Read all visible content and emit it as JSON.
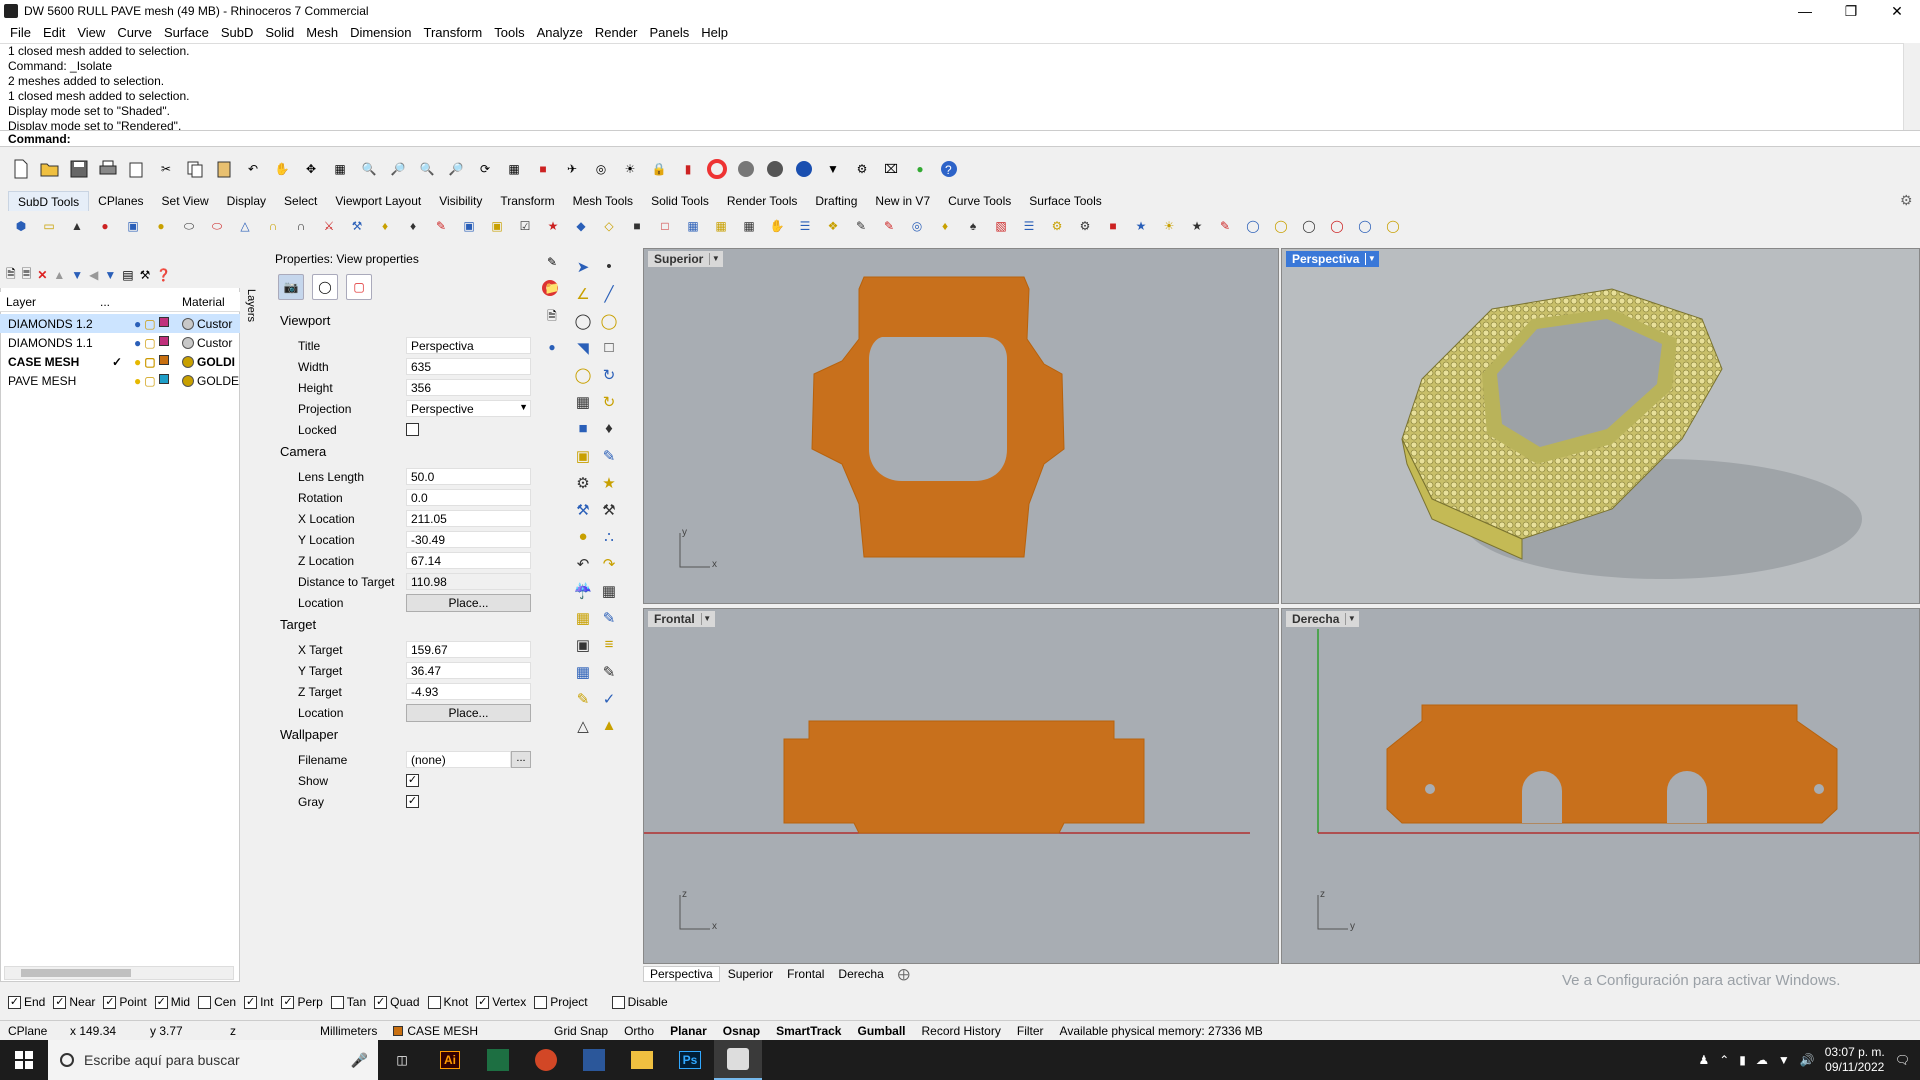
{
  "window": {
    "title": "DW 5600 RULL PAVE mesh (49 MB) - Rhinoceros 7 Commercial"
  },
  "menu": [
    "File",
    "Edit",
    "View",
    "Curve",
    "Surface",
    "SubD",
    "Solid",
    "Mesh",
    "Dimension",
    "Transform",
    "Tools",
    "Analyze",
    "Render",
    "Panels",
    "Help"
  ],
  "command_history": [
    "1 closed mesh added to selection.",
    "Command: _Isolate",
    "2 meshes added to selection.",
    "1 closed mesh added to selection.",
    "Display mode set to \"Shaded\".",
    "Display mode set to \"Rendered\"."
  ],
  "command_prompt": "Command:",
  "toolbar_tabs": [
    "SubD Tools",
    "CPlanes",
    "Set View",
    "Display",
    "Select",
    "Viewport Layout",
    "Visibility",
    "Transform",
    "Mesh Tools",
    "Solid Tools",
    "Render Tools",
    "Drafting",
    "New in V7",
    "Curve Tools",
    "Surface Tools"
  ],
  "layers": {
    "headers": {
      "layer": "Layer",
      "current": "...",
      "material": "Material"
    },
    "rows": [
      {
        "name": "DIAMONDS 1.2",
        "current": "",
        "material": "Custor",
        "color": "#c0307c",
        "selected": true,
        "bold": false
      },
      {
        "name": "DIAMONDS 1.1",
        "current": "",
        "material": "Custor",
        "color": "#c0307c",
        "selected": false,
        "bold": false
      },
      {
        "name": "CASE MESH",
        "current": "✓",
        "material": "GOLDI",
        "color": "#c86f10",
        "selected": false,
        "bold": true
      },
      {
        "name": "PAVE MESH",
        "current": "",
        "material": "GOLDE",
        "color": "#1e9ec8",
        "selected": false,
        "bold": false
      }
    ],
    "side_label": "Layers"
  },
  "properties": {
    "title": "Properties: View properties",
    "sections": {
      "viewport": "Viewport",
      "camera": "Camera",
      "target": "Target",
      "wallpaper": "Wallpaper"
    },
    "viewport": {
      "title_label": "Title",
      "title": "Perspectiva",
      "width_label": "Width",
      "width": "635",
      "height_label": "Height",
      "height": "356",
      "projection_label": "Projection",
      "projection": "Perspective",
      "locked_label": "Locked"
    },
    "camera": {
      "lens_label": "Lens Length",
      "lens": "50.0",
      "rotation_label": "Rotation",
      "rotation": "0.0",
      "xloc_label": "X Location",
      "xloc": "211.05",
      "yloc_label": "Y Location",
      "yloc": "-30.49",
      "zloc_label": "Z Location",
      "zloc": "67.14",
      "dist_label": "Distance to Target",
      "dist": "110.98",
      "location_label": "Location",
      "place": "Place..."
    },
    "target": {
      "x_label": "X Target",
      "x": "159.67",
      "y_label": "Y Target",
      "y": "36.47",
      "z_label": "Z Target",
      "z": "-4.93",
      "location_label": "Location",
      "place": "Place..."
    },
    "wallpaper": {
      "filename_label": "Filename",
      "filename": "(none)",
      "browse": "...",
      "show_label": "Show",
      "gray_label": "Gray"
    }
  },
  "viewports": {
    "superior": "Superior",
    "perspectiva": "Perspectiva",
    "frontal": "Frontal",
    "derecha": "Derecha",
    "axes": {
      "x": "x",
      "y": "y",
      "z": "z"
    }
  },
  "viewport_tabs": [
    "Perspectiva",
    "Superior",
    "Frontal",
    "Derecha"
  ],
  "watermark": "Ve a Configuración para activar Windows.",
  "osnaps": [
    {
      "label": "End",
      "checked": true
    },
    {
      "label": "Near",
      "checked": true
    },
    {
      "label": "Point",
      "checked": true
    },
    {
      "label": "Mid",
      "checked": true
    },
    {
      "label": "Cen",
      "checked": false
    },
    {
      "label": "Int",
      "checked": true
    },
    {
      "label": "Perp",
      "checked": true
    },
    {
      "label": "Tan",
      "checked": false
    },
    {
      "label": "Quad",
      "checked": true
    },
    {
      "label": "Knot",
      "checked": false
    },
    {
      "label": "Vertex",
      "checked": true
    },
    {
      "label": "Project",
      "checked": false
    },
    {
      "label": "Disable",
      "checked": false
    }
  ],
  "status": {
    "cplane": "CPlane",
    "x": "x 149.34",
    "y": "y 3.77",
    "z": "z",
    "units": "Millimeters",
    "layer": "CASE MESH",
    "gridsnap": "Grid Snap",
    "ortho": "Ortho",
    "planar": "Planar",
    "osnap": "Osnap",
    "smarttrack": "SmartTrack",
    "gumball": "Gumball",
    "history": "Record History",
    "filter": "Filter",
    "memory": "Available physical memory: 27336 MB"
  },
  "taskbar": {
    "search_placeholder": "Escribe aquí para buscar",
    "time": "03:07 p. m.",
    "date": "09/11/2022"
  },
  "colors": {
    "gold_mesh": "#c8701c",
    "viewport_bg": "#a8adb3",
    "pave": "#d8d07a",
    "accent": "#3a78d8"
  }
}
